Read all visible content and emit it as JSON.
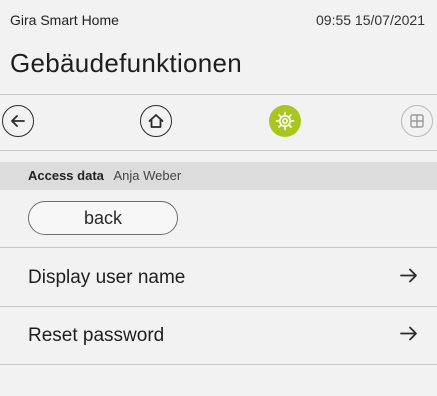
{
  "status_bar": {
    "app_name": "Gira Smart Home",
    "datetime": "09:55 15/07/2021"
  },
  "page": {
    "title": "Gebäudefunktionen"
  },
  "nav": {
    "back_icon": "arrow-left-icon",
    "home_icon": "house-icon",
    "settings_icon": "gear-icon",
    "grid_icon": "grid-icon",
    "active_color": "#a8c61f"
  },
  "section": {
    "label": "Access data",
    "user": "Anja Weber"
  },
  "back_button": {
    "label": "back"
  },
  "menu": {
    "items": [
      {
        "label": "Display user name",
        "icon": "arrow-right-icon"
      },
      {
        "label": "Reset password",
        "icon": "arrow-right-icon"
      }
    ]
  }
}
